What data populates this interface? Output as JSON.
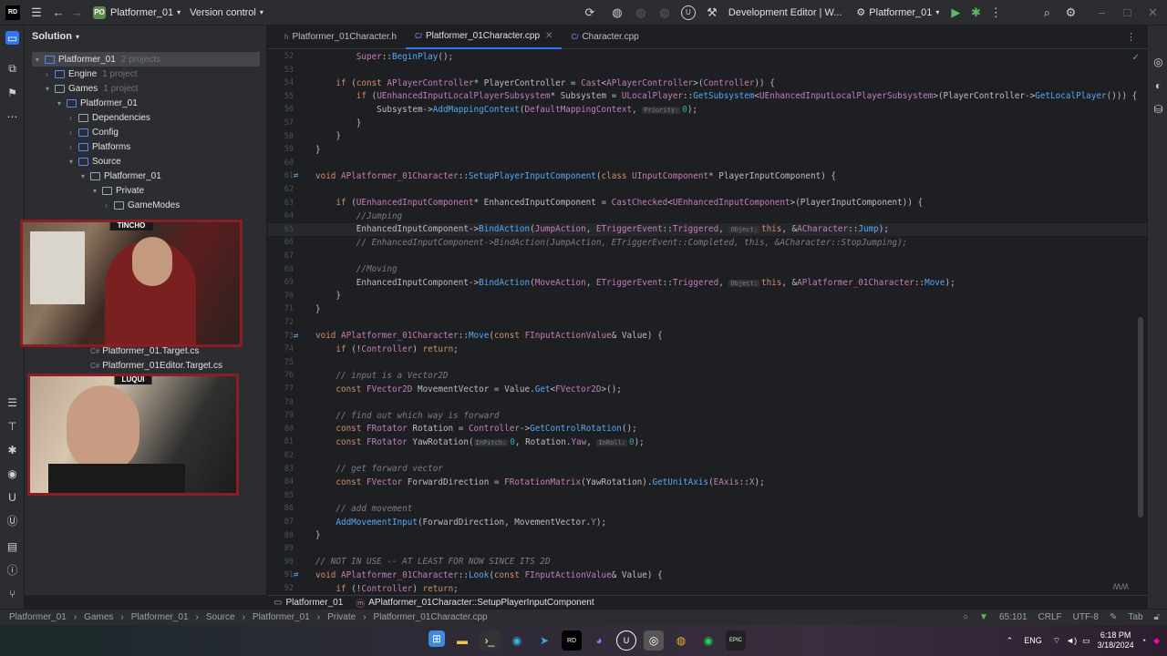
{
  "titlebar": {
    "project_badge": "PO",
    "project_name": "Platformer_01",
    "version_control": "Version control",
    "config": "Development Editor | W...",
    "run_target": "Platformer_01"
  },
  "project_panel": {
    "title": "Solution",
    "tree": [
      {
        "label": "Platformer_01",
        "meta": "2 projects"
      },
      {
        "label": "Engine",
        "meta": "1 project"
      },
      {
        "label": "Games",
        "meta": "1 project"
      },
      {
        "label": "Platformer_01",
        "meta": ""
      },
      {
        "label": "Dependencies",
        "meta": ""
      },
      {
        "label": "Config",
        "meta": ""
      },
      {
        "label": "Platforms",
        "meta": ""
      },
      {
        "label": "Source",
        "meta": ""
      },
      {
        "label": "Platformer_01",
        "meta": ""
      },
      {
        "label": "Private",
        "meta": ""
      },
      {
        "label": "GameModes",
        "meta": ""
      },
      {
        "label": "Platformer_01.Target.cs",
        "meta": ""
      },
      {
        "label": "Platformer_01Editor.Target.cs",
        "meta": ""
      }
    ]
  },
  "tabs": [
    {
      "label": "Platformer_01Character.h",
      "icon": "h"
    },
    {
      "label": "Platformer_01Character.cpp",
      "icon": "C/"
    },
    {
      "label": "Character.cpp",
      "icon": "C/"
    }
  ],
  "webcams": {
    "top_name": "TINCHO",
    "bottom_name": "LUQUI"
  },
  "code_lines": [
    {
      "n": "52",
      "html": "        <span class='ty'>Super</span>::<span class='fn'>BeginPlay</span>();"
    },
    {
      "n": "53",
      "html": ""
    },
    {
      "n": "54",
      "html": "    <span class='kw'>if</span> (<span class='kw'>const</span> <span class='ty'>APlayerController</span>* PlayerController = <span class='ty'>Cast</span>&lt;<span class='ty'>APlayerController</span>&gt;(<span class='ty'>Controller</span>)) {"
    },
    {
      "n": "55",
      "html": "        <span class='kw'>if</span> (<span class='ty'>UEnhancedInputLocalPlayerSubsystem</span>* Subsystem = <span class='ty'>ULocalPlayer</span>::<span class='fn'>GetSubsystem</span>&lt;<span class='ty'>UEnhancedInputLocalPlayerSubsystem</span>&gt;(PlayerController-&gt;<span class='fn'>GetLocalPlayer</span>())) {"
    },
    {
      "n": "56",
      "html": "            Subsystem-&gt;<span class='fn'>AddMappingContext</span>(<span class='ty'>DefaultMappingContext</span>, <span class='ins'>Priority:</span><span class='num'>0</span>);"
    },
    {
      "n": "57",
      "html": "        }"
    },
    {
      "n": "58",
      "html": "    }"
    },
    {
      "n": "59",
      "html": "}"
    },
    {
      "n": "60",
      "html": ""
    },
    {
      "n": "61",
      "html": "<span class='kw'>void</span> <span class='ty'>APlatformer_01Character</span>::<span class='fn'>SetupPlayerInputComponent</span>(<span class='kw'>class</span> <span class='ty'>UInputComponent</span>* PlayerInputComponent) {"
    },
    {
      "n": "62",
      "html": ""
    },
    {
      "n": "63",
      "html": "    <span class='kw'>if</span> (<span class='ty'>UEnhancedInputComponent</span>* EnhancedInputComponent = <span class='ty'>CastChecked</span>&lt;<span class='ty'>UEnhancedInputComponent</span>&gt;(PlayerInputComponent)) {"
    },
    {
      "n": "64",
      "html": "        <span class='cm'>//Jumping</span>"
    },
    {
      "n": "65",
      "html": "        EnhancedInputComponent-&gt;<span class='fn'>BindAction</span>(<span class='ty'>JumpAction</span>, <span class='ty'>ETriggerEvent</span>::<span class='ty'>Triggered</span>, <span class='ins'>Object:</span><span class='kw'>this</span>, &amp;<span class='ty'>ACharacter</span>::<span class='fn'>Jump</span>);"
    },
    {
      "n": "66",
      "html": "        <span class='cm'>// EnhancedInputComponent-&gt;BindAction(JumpAction, ETriggerEvent::Completed, this, &amp;ACharacter::StopJumping);</span>"
    },
    {
      "n": "67",
      "html": ""
    },
    {
      "n": "68",
      "html": "        <span class='cm'>//Moving</span>"
    },
    {
      "n": "69",
      "html": "        EnhancedInputComponent-&gt;<span class='fn'>BindAction</span>(<span class='ty'>MoveAction</span>, <span class='ty'>ETriggerEvent</span>::<span class='ty'>Triggered</span>, <span class='ins'>Object:</span><span class='kw'>this</span>, &amp;<span class='ty'>APlatformer_01Character</span>::<span class='fn'>Move</span>);"
    },
    {
      "n": "70",
      "html": "    }"
    },
    {
      "n": "71",
      "html": "}"
    },
    {
      "n": "72",
      "html": ""
    },
    {
      "n": "73",
      "html": "<span class='kw'>void</span> <span class='ty'>APlatformer_01Character</span>::<span class='fn'>Move</span>(<span class='kw'>const</span> <span class='ty'>FInputActionValue</span>&amp; Value) {"
    },
    {
      "n": "74",
      "html": "    <span class='kw'>if</span> (!<span class='ty'>Controller</span>) <span class='kw'>return</span>;"
    },
    {
      "n": "75",
      "html": ""
    },
    {
      "n": "76",
      "html": "    <span class='cm'>// input is a Vector2D</span>"
    },
    {
      "n": "77",
      "html": "    <span class='kw'>const</span> <span class='ty'>FVector2D</span> MovementVector = Value.<span class='fn'>Get</span>&lt;<span class='ty'>FVector2D</span>&gt;();"
    },
    {
      "n": "78",
      "html": ""
    },
    {
      "n": "79",
      "html": "    <span class='cm'>// find out which way is forward</span>"
    },
    {
      "n": "80",
      "html": "    <span class='kw'>const</span> <span class='ty'>FRotator</span> Rotation = <span class='ty'>Controller</span>-&gt;<span class='fn'>GetControlRotation</span>();"
    },
    {
      "n": "81",
      "html": "    <span class='kw'>const</span> <span class='ty'>FRotator</span> YawRotation(<span class='ins'>InPitch:</span><span class='num'>0</span>, Rotation.<span class='ty'>Yaw</span>, <span class='ins'>InRoll:</span><span class='num'>0</span>);"
    },
    {
      "n": "82",
      "html": ""
    },
    {
      "n": "83",
      "html": "    <span class='cm'>// get forward vector</span>"
    },
    {
      "n": "84",
      "html": "    <span class='kw'>const</span> <span class='ty'>FVector</span> ForwardDirection = <span class='ty'>FRotationMatrix</span>(YawRotation).<span class='fn'>GetUnitAxis</span>(<span class='ty'>EAxis</span>::<span class='ty'>X</span>);"
    },
    {
      "n": "85",
      "html": ""
    },
    {
      "n": "86",
      "html": "    <span class='cm'>// add movement</span>"
    },
    {
      "n": "87",
      "html": "    <span class='fn'>AddMovementInput</span>(ForwardDirection, MovementVector.<span class='ty'>Y</span>);"
    },
    {
      "n": "88",
      "html": "}"
    },
    {
      "n": "89",
      "html": ""
    },
    {
      "n": "90",
      "html": "<span class='cm'>// NOT IN USE -- AT LEAST FOR NOW SINCE ITS 2D</span>"
    },
    {
      "n": "91",
      "html": "<span class='kw'>void</span> <span class='ty'>APlatformer_01Character</span>::<span class='fn'>Look</span>(<span class='kw'>const</span> <span class='ty'>FInputActionValue</span>&amp; Value) {"
    },
    {
      "n": "92",
      "html": "    <span class='kw'>if</span> (!<span class='ty'>Controller</span>) <span class='kw'>return</span>;"
    }
  ],
  "nav_breadcrumb": {
    "file": "Platformer_01",
    "symbol": "APlatformer_01Character::SetupPlayerInputComponent"
  },
  "statusbar": {
    "crumbs": [
      "Platformer_01",
      "Games",
      "Platformer_01",
      "Source",
      "Platformer_01",
      "Private",
      "Platformer_01Character.cpp"
    ],
    "position": "65:101",
    "line_ending": "CRLF",
    "encoding": "UTF-8",
    "indent": "Tab"
  },
  "taskbar": {
    "lang": "ENG",
    "time": "6:18 PM",
    "date": "3/18/2024"
  }
}
